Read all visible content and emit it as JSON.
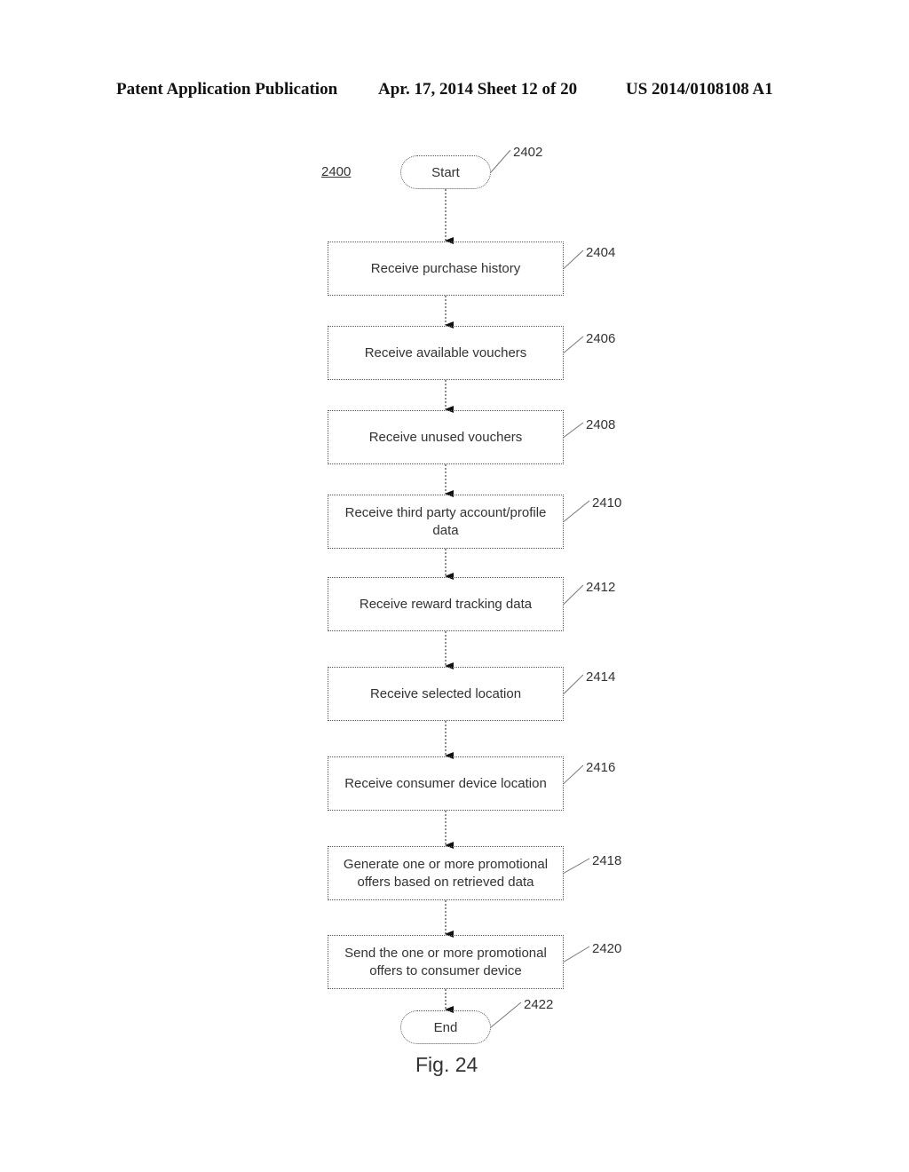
{
  "header": {
    "publication": "Patent Application Publication",
    "date_sheet": "Apr. 17, 2014  Sheet 12 of 20",
    "number": "US 2014/0108108 A1"
  },
  "figure": {
    "id": "2400",
    "caption": "Fig. 24",
    "start": {
      "label": "Start",
      "ref": "2402"
    },
    "end": {
      "label": "End",
      "ref": "2422"
    },
    "steps": [
      {
        "label": "Receive purchase history",
        "ref": "2404"
      },
      {
        "label": "Receive available vouchers",
        "ref": "2406"
      },
      {
        "label": "Receive unused vouchers",
        "ref": "2408"
      },
      {
        "label": "Receive third party account/profile data",
        "ref": "2410"
      },
      {
        "label": "Receive reward tracking data",
        "ref": "2412"
      },
      {
        "label": "Receive selected location",
        "ref": "2414"
      },
      {
        "label": "Receive consumer device location",
        "ref": "2416"
      },
      {
        "label": "Generate one or more promotional offers based on retrieved data",
        "ref": "2418"
      },
      {
        "label": "Send the one or more promotional offers to consumer device",
        "ref": "2420"
      }
    ]
  }
}
